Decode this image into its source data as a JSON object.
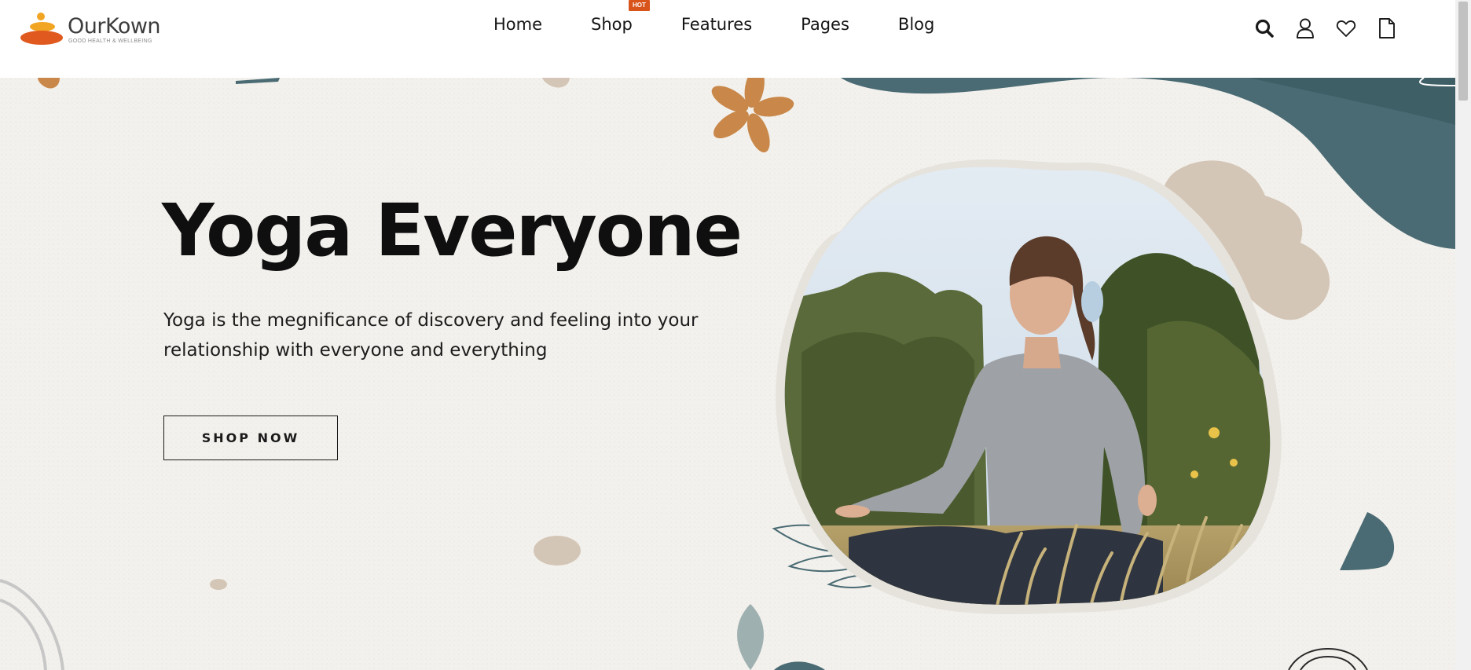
{
  "brand": {
    "name": "OurKown",
    "tagline": "GOOD HEALTH & WELLBEING"
  },
  "nav": {
    "items": [
      {
        "label": "Home"
      },
      {
        "label": "Shop",
        "badge": "HOT"
      },
      {
        "label": "Features"
      },
      {
        "label": "Pages"
      },
      {
        "label": "Blog"
      }
    ]
  },
  "header_icons": [
    "search-icon",
    "user-icon",
    "heart-icon",
    "cart-icon"
  ],
  "hero": {
    "title": "Yoga Everyone",
    "subtitle": "Yoga is the megnificance of discovery and feeling into your relationship with everyone and everything",
    "cta_label": "SHOP NOW"
  },
  "colors": {
    "accent_orange": "#e0591e",
    "brand_yellow": "#f2a423",
    "teal": "#4a6b73",
    "beige": "#d4c6b6",
    "flower_orange": "#c9884a",
    "hot_badge": "#d8541b",
    "hero_background": "#f3f1ed"
  }
}
